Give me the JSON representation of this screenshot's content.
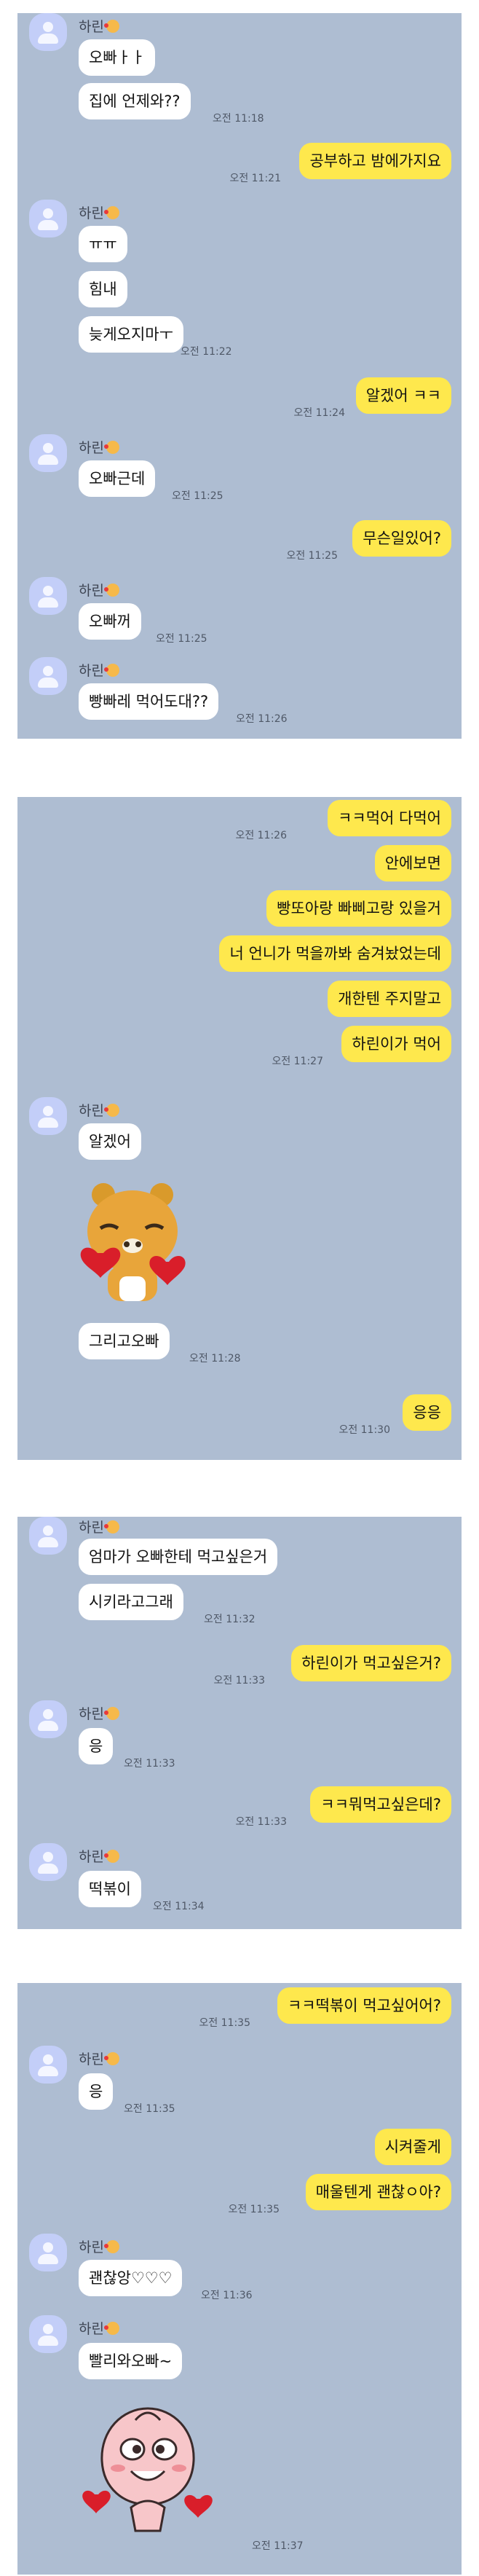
{
  "contact": {
    "name": "하린",
    "avatar_icon": "default-profile-icon",
    "name_emoji": "smiling-face-with-hearts-emoji"
  },
  "colors": {
    "chat_background": "#aebdd2",
    "incoming_bubble": "#ffffff",
    "outgoing_bubble": "#fee84d"
  },
  "panels": [
    {
      "messages": [
        {
          "text": "오빠ㅏㅏ"
        },
        {
          "text": "집에 언제와??",
          "time": "오전 11:18"
        },
        {
          "text": "공부하고 밤에가지요",
          "time": "오전 11:21"
        },
        {
          "text": "ㅠㅠ"
        },
        {
          "text": "힘내"
        },
        {
          "text": "늦게오지마ㅜ",
          "time": "오전 11:22"
        },
        {
          "text": "알겠어 ㅋㅋ",
          "time": "오전 11:24"
        },
        {
          "text": "오빠근데",
          "time": "오전 11:25"
        },
        {
          "text": "무슨일있어?",
          "time": "오전 11:25"
        },
        {
          "text": "오빠꺼",
          "time": "오전 11:25"
        },
        {
          "text": "빵빠레 먹어도대??",
          "time": "오전 11:26"
        }
      ]
    },
    {
      "messages": [
        {
          "text": "ㅋㅋ먹어 다먹어",
          "time": "오전 11:26"
        },
        {
          "text": "안에보면"
        },
        {
          "text": "빵또아랑 빠삐고랑 있을거"
        },
        {
          "text": "너 언니가 먹을까봐 숨겨놨었는데"
        },
        {
          "text": "개한텐 주지말고"
        },
        {
          "text": "하린이가 먹어",
          "time": "오전 11:27"
        },
        {
          "text": "알겠어"
        },
        {
          "sticker": "ryan-hearts-sticker"
        },
        {
          "text": "그리고오빠",
          "time": "오전 11:28"
        },
        {
          "text": "응응",
          "time": "오전 11:30"
        }
      ]
    },
    {
      "messages": [
        {
          "text": "엄마가 오빠한테 먹고싶은거"
        },
        {
          "text": "시키라고그래",
          "time": "오전 11:32"
        },
        {
          "text": "하린이가 먹고싶은거?",
          "time": "오전 11:33"
        },
        {
          "text": "응",
          "time": "오전 11:33"
        },
        {
          "text": "ㅋㅋ뭐먹고싶은데?",
          "time": "오전 11:33"
        },
        {
          "text": "떡볶이",
          "time": "오전 11:34"
        }
      ]
    },
    {
      "messages": [
        {
          "text": "ㅋㅋ떡볶이 먹고싶어어?",
          "time": "오전 11:35"
        },
        {
          "text": "응",
          "time": "오전 11:35"
        },
        {
          "text": "시켜줄게"
        },
        {
          "text": "매울텐게 괜찮ㅇ아?",
          "time": "오전 11:35"
        },
        {
          "text": "괜찮앙♡♡♡",
          "time": "오전 11:36"
        },
        {
          "text": "빨리와오빠~"
        },
        {
          "sticker": "apeach-hearts-sticker",
          "time": "오전 11:37"
        }
      ]
    }
  ]
}
